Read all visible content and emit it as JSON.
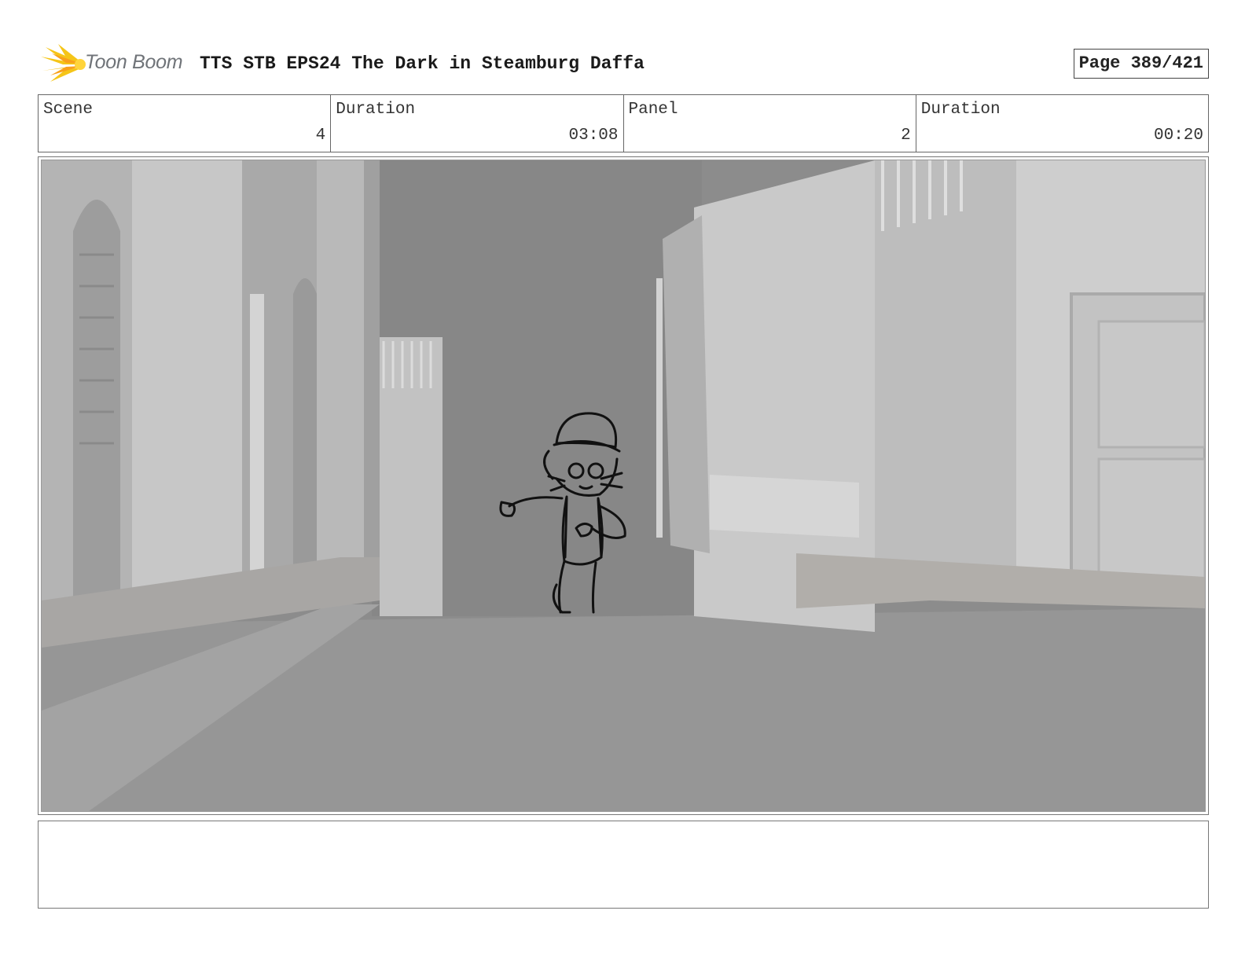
{
  "header": {
    "logo_text": "Toon Boom",
    "title": "TTS STB EPS24 The Dark in Steamburg Daffa",
    "page_label": "Page 389/421"
  },
  "info": {
    "scene_label": "Scene",
    "scene_value": "4",
    "scene_duration_label": "Duration",
    "scene_duration_value": "03:08",
    "panel_label": "Panel",
    "panel_value": "2",
    "panel_duration_label": "Duration",
    "panel_duration_value": "00:20"
  },
  "colors": {
    "logo_accent": "#f5c518",
    "frame_border": "#777777"
  },
  "notes": {
    "text": ""
  }
}
